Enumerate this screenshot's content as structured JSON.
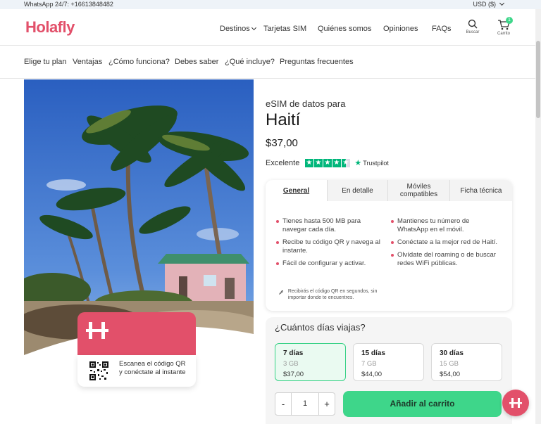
{
  "topbar": {
    "whatsapp": "WhatsApp 24/7: +16613848482",
    "currency": "USD ($)"
  },
  "header": {
    "logo": "Holafly",
    "nav": [
      "Destinos",
      "Tarjetas SIM",
      "Quiénes somos",
      "Opiniones",
      "FAQs"
    ],
    "search_label": "Buscar",
    "cart_label": "Carrito",
    "cart_count": "1"
  },
  "subnav": [
    "Elige tu plan",
    "Ventajas",
    "¿Cómo funciona?",
    "Debes saber",
    "¿Qué incluye?",
    "Preguntas frecuentes"
  ],
  "promo_card": {
    "text": "Escanea el código QR y conéctate al instante"
  },
  "product": {
    "kicker": "eSIM de datos para",
    "title": "Haití",
    "price": "$37,00",
    "rating_label": "Excelente",
    "rating_stars": 4.5,
    "trustpilot": "Trustpilot"
  },
  "tabs": [
    "General",
    "En detalle",
    "Móviles compatibles",
    "Ficha técnica"
  ],
  "features_left": [
    "Tienes hasta 500 MB para navegar cada día.",
    "Recibe tu código QR y navega al instante.",
    "Fácil de configurar y activar."
  ],
  "features_right": [
    "Mantienes tu número de WhatsApp en el móvil.",
    "Conéctate a la mejor red de Haití.",
    "Olvídate del roaming o de buscar redes WiFi públicas."
  ],
  "qr_note": "Recibirás el código QR en segundos, sin importar donde te encuentres.",
  "days": {
    "question": "¿Cuántos días viajas?",
    "options": [
      {
        "days": "7 días",
        "data": "3 GB",
        "price": "$37,00"
      },
      {
        "days": "15 días",
        "data": "7 GB",
        "price": "$44,00"
      },
      {
        "days": "30 días",
        "data": "15 GB",
        "price": "$54,00"
      }
    ]
  },
  "cart": {
    "minus": "-",
    "quantity": "1",
    "plus": "+",
    "add_label": "Añadir al carrito"
  },
  "colors": {
    "brand": "#e2506a",
    "accent_green": "#3ed68a",
    "trustpilot_green": "#00b67a"
  }
}
